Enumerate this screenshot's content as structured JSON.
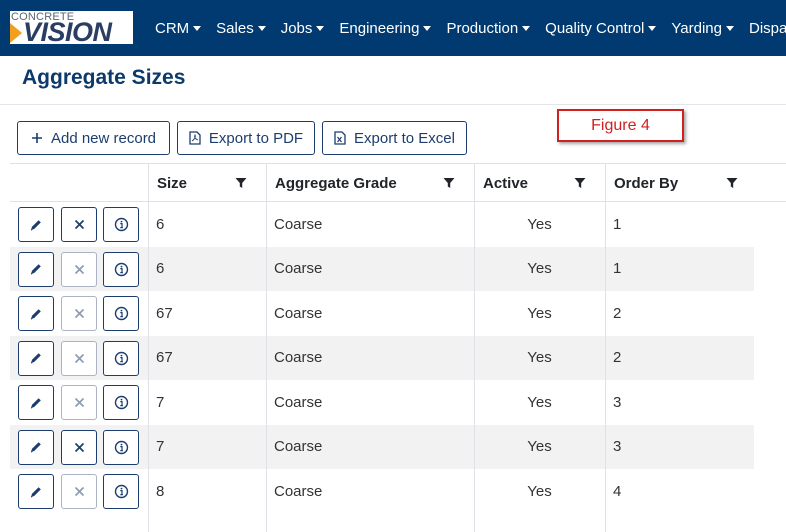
{
  "brand": {
    "logo_top": "CONCRETE",
    "logo_main": "VISION",
    "accent": "#f0a01c"
  },
  "nav": {
    "items": [
      {
        "label": "CRM"
      },
      {
        "label": "Sales"
      },
      {
        "label": "Jobs"
      },
      {
        "label": "Engineering"
      },
      {
        "label": "Production"
      },
      {
        "label": "Quality Control"
      },
      {
        "label": "Yarding"
      },
      {
        "label": "Dispatch"
      }
    ],
    "background": "#003a70"
  },
  "page": {
    "title": "Aggregate Sizes"
  },
  "toolbar": {
    "add_label": "Add new record",
    "pdf_label": "Export to PDF",
    "excel_label": "Export to Excel",
    "pdf_icon_text": "PDF",
    "excel_icon_text": "X"
  },
  "figure_label": "Figure 4",
  "table": {
    "columns": [
      "Size",
      "Aggregate Grade",
      "Active",
      "Order By"
    ],
    "rows": [
      {
        "size": "6",
        "grade": "Coarse",
        "active": "Yes",
        "order": "1",
        "delete_enabled": true
      },
      {
        "size": "6",
        "grade": "Coarse",
        "active": "Yes",
        "order": "1",
        "delete_enabled": false
      },
      {
        "size": "67",
        "grade": "Coarse",
        "active": "Yes",
        "order": "2",
        "delete_enabled": false
      },
      {
        "size": "67",
        "grade": "Coarse",
        "active": "Yes",
        "order": "2",
        "delete_enabled": false
      },
      {
        "size": "7",
        "grade": "Coarse",
        "active": "Yes",
        "order": "3",
        "delete_enabled": false
      },
      {
        "size": "7",
        "grade": "Coarse",
        "active": "Yes",
        "order": "3",
        "delete_enabled": true
      },
      {
        "size": "8",
        "grade": "Coarse",
        "active": "Yes",
        "order": "4",
        "delete_enabled": false
      }
    ]
  }
}
